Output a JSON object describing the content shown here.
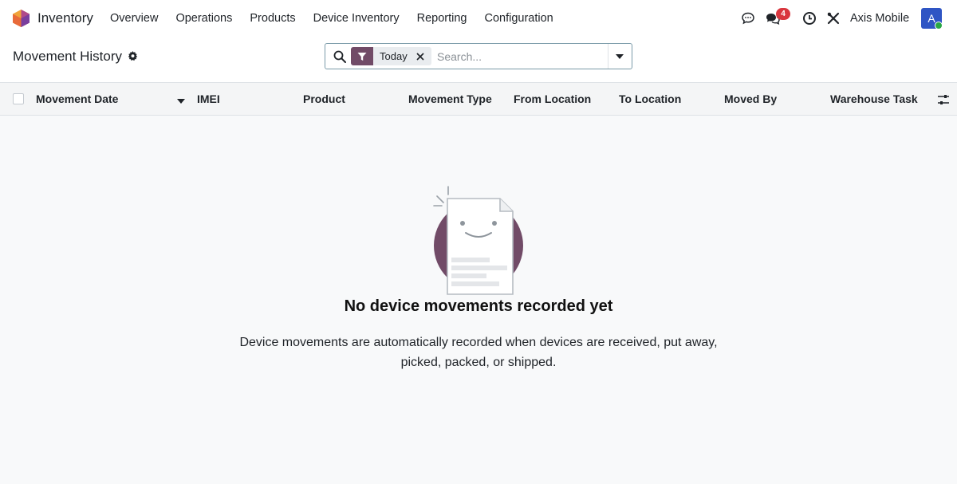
{
  "navbar": {
    "app_name": "Inventory",
    "menu": [
      {
        "label": "Overview"
      },
      {
        "label": "Operations"
      },
      {
        "label": "Products"
      },
      {
        "label": "Device Inventory"
      },
      {
        "label": "Reporting"
      },
      {
        "label": "Configuration"
      }
    ],
    "systray": {
      "messages_badge": "4",
      "company": "Axis Mobile",
      "avatar_letter": "A"
    }
  },
  "control_panel": {
    "title": "Movement History",
    "search": {
      "facet_label": "Today",
      "placeholder": "Search..."
    }
  },
  "table": {
    "columns": [
      {
        "label": "Movement Date"
      },
      {
        "label": "IMEI"
      },
      {
        "label": "Product"
      },
      {
        "label": "Movement Type"
      },
      {
        "label": "From Location"
      },
      {
        "label": "To Location"
      },
      {
        "label": "Moved By"
      },
      {
        "label": "Warehouse Task"
      }
    ]
  },
  "empty_state": {
    "title": "No device movements recorded yet",
    "message": "Device movements are automatically recorded when devices are received, put away, picked, packed, or shipped."
  },
  "colors": {
    "brand": "#714b67",
    "badge": "#d9363e",
    "avatar": "#2f55c4"
  }
}
